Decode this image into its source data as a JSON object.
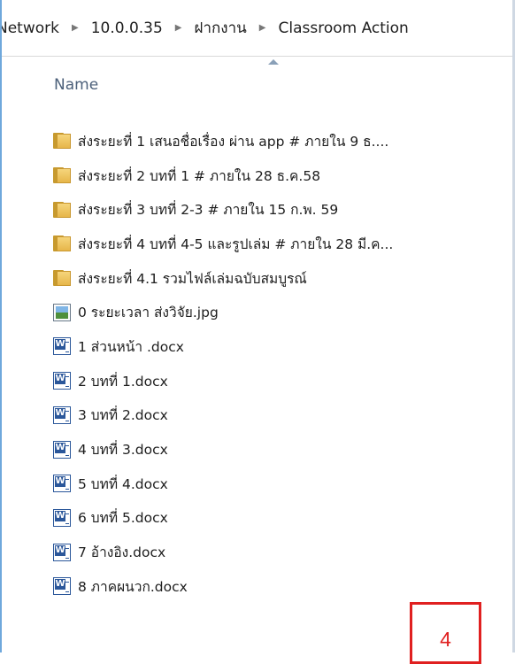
{
  "breadcrumb": [
    "Network",
    "10.0.0.35",
    "ฝากงาน",
    "Classroom Action"
  ],
  "column_header": "Name",
  "files": [
    {
      "type": "folder",
      "name": "ส่งระยะที่ 1 เสนอชื่อเรื่อง  ผ่าน app # ภายใน 9 ธ...."
    },
    {
      "type": "folder",
      "name": "ส่งระยะที่ 2 บทที่ 1  # ภายใน 28 ธ.ค.58"
    },
    {
      "type": "folder",
      "name": "ส่งระยะที่ 3 บทที่ 2-3 # ภายใน  15  ก.พ. 59"
    },
    {
      "type": "folder",
      "name": "ส่งระยะที่ 4 บทที่ 4-5  และรูปเล่ม # ภายใน 28 มี.ค..."
    },
    {
      "type": "folder",
      "name": "ส่งระยะที่ 4.1  รวมไฟล์เล่มฉบับสมบูรณ์"
    },
    {
      "type": "image",
      "name": "0  ระยะเวลา ส่งวิจัย.jpg"
    },
    {
      "type": "word",
      "name": "1  ส่วนหน้า  .docx"
    },
    {
      "type": "word",
      "name": "2  บทที่ 1.docx"
    },
    {
      "type": "word",
      "name": "3  บทที่ 2.docx"
    },
    {
      "type": "word",
      "name": "4  บทที่ 3.docx"
    },
    {
      "type": "word",
      "name": "5  บทที่ 4.docx"
    },
    {
      "type": "word",
      "name": "6  บทที่ 5.docx"
    },
    {
      "type": "word",
      "name": "7  อ้างอิง.docx"
    },
    {
      "type": "word",
      "name": "8  ภาคผนวก.docx"
    }
  ],
  "annotation": "4",
  "colors": {
    "annotation": "#e02020",
    "header_text": "#4c607a",
    "word_blue": "#2b579a",
    "folder": "#e7b64a"
  }
}
